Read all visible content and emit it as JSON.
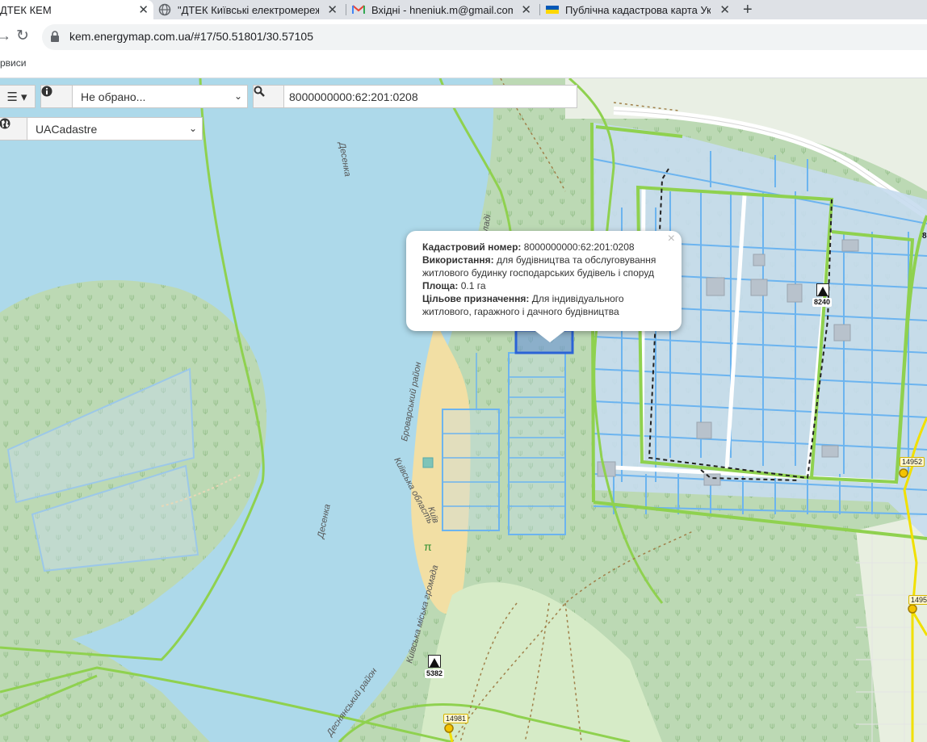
{
  "browser": {
    "tabs": [
      {
        "title": "ДТЕК КЕМ",
        "favicon": "dtek-favicon",
        "active": true
      },
      {
        "title": "\"ДТЕК Київські електромережі\"",
        "favicon": "globe-icon"
      },
      {
        "title": "Вхідні - hneniuk.m@gmail.com -",
        "favicon": "gmail-icon"
      },
      {
        "title": "Публічна кадастрова карта Укр",
        "favicon": "ukraine-flag-icon"
      }
    ],
    "tab_close": "✕",
    "new_tab": "+",
    "url": "kem.energymap.com.ua/#17/50.51801/30.57105",
    "bookmarks_text": "рвиси"
  },
  "map_controls": {
    "layers_select_value": "Не обрано...",
    "search_value": "8000000000:62:201:0208",
    "basemap_select_value": "UACadastre"
  },
  "popup": {
    "cad_label": "Кадастровий номер:",
    "cad_value": "8000000000:62:201:0208",
    "usage_label": "Використання:",
    "usage_value_line1": "для будівництва та обслуговування",
    "usage_value_line2": "житлового будинку господарських будівель і споруд",
    "area_label": "Площа:",
    "area_value": "0.1 га",
    "purpose_label": "Цільове призначення:",
    "purpose_value_line1": "Для індивідуального",
    "purpose_value_line2": "житлового, гаражного і дачного будівництва",
    "close": "×"
  },
  "map_labels": {
    "river1": "Десенка",
    "river2": "Десенка",
    "district1": "Броварський район",
    "region": "Київська область",
    "city": "Київ",
    "gromada": "Київська міська громада",
    "district2": "Деснянський район",
    "street_fragment": "ладі"
  },
  "markers": [
    {
      "label": "8240"
    },
    {
      "label": "5382"
    }
  ],
  "number_labels": [
    "14952",
    "1495",
    "14981"
  ],
  "edge_label": "8",
  "colors": {
    "water": "#add9ea",
    "forest": "#bcd9b4",
    "parcel_fill": "#c7dcee",
    "parcel_line": "#6cb4ef",
    "boundary": "#8fd14f",
    "highlight": "#2b63d6"
  }
}
